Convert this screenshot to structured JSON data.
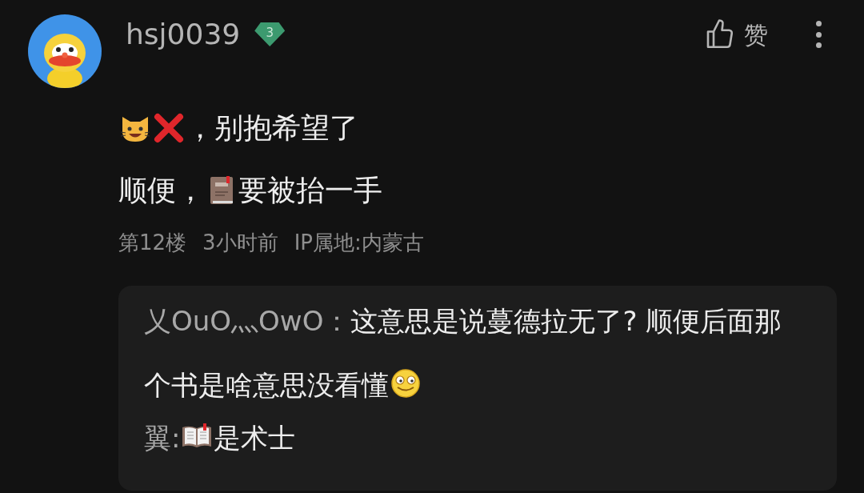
{
  "comment": {
    "author": "hsj0039",
    "level_badge": "3",
    "like_label": "赞",
    "body_lines": [
      [
        {
          "kind": "cat"
        },
        {
          "kind": "cross"
        },
        {
          "kind": "text",
          "text": "，别抱希望了"
        }
      ],
      [
        {
          "kind": "text",
          "text": "顺便，"
        },
        {
          "kind": "book"
        },
        {
          "kind": "text",
          "text": "要被抬一手"
        }
      ]
    ],
    "meta": [
      "第12楼",
      "3小时前",
      "IP属地:内蒙古"
    ],
    "replies": [
      {
        "author": "乂OuO灬OwO",
        "separator": "：",
        "parts": [
          {
            "kind": "text",
            "text": "这意思是说蔓德拉无了? 顺便后面那个书是啥意思没看懂"
          },
          {
            "kind": "grin"
          }
        ]
      },
      {
        "author": "翼",
        "separator": ":",
        "parts": [
          {
            "kind": "openbook"
          },
          {
            "kind": "text",
            "text": "是术士"
          }
        ]
      }
    ]
  }
}
